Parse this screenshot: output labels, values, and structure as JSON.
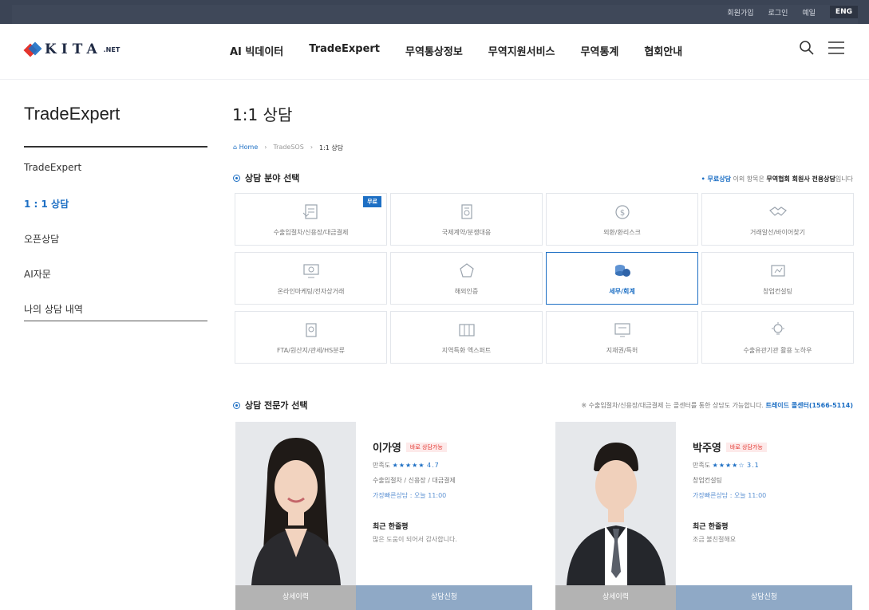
{
  "util_bar": {
    "links": [
      "회원가입",
      "로그인",
      "예일"
    ],
    "eng": "ENG"
  },
  "header": {
    "logo_text": "KITA",
    "logo_suffix": ".NET",
    "nav": [
      "AI 빅데이터",
      "TradeExpert",
      "무역통상정보",
      "무역지원서비스",
      "무역통계",
      "협회안내"
    ],
    "icons": [
      "search-icon",
      "menu-icon"
    ]
  },
  "sidebar": {
    "title": "TradeExpert",
    "items": [
      {
        "label": "TradeExpert",
        "active": false
      },
      {
        "label": "1 : 1 상담",
        "active": true
      },
      {
        "label": "오픈상담",
        "active": false
      },
      {
        "label": "AI자문",
        "active": false
      },
      {
        "label": "나의 상담 내역",
        "active": false
      }
    ]
  },
  "main": {
    "title": "1:1 상담",
    "breadcrumb": {
      "home": "Home",
      "mid": "TradeSOS",
      "current": "1:1 상담"
    },
    "field_section": {
      "heading": "상담 분야 선택",
      "note_blue": "• 무료상담",
      "note_mid": " 이외 항목은 ",
      "note_strong": "무역협회 회원사 전용상담",
      "note_end": "입니다"
    },
    "categories": [
      {
        "label": "수출입절차/신용장/대금결제",
        "icon": "document-icon",
        "badge": "무료"
      },
      {
        "label": "국제계약/분쟁대응",
        "icon": "contract-icon"
      },
      {
        "label": "외환/환리스크",
        "icon": "dollar-coin-icon"
      },
      {
        "label": "거래알선/바이어찾기",
        "icon": "handshake-icon"
      },
      {
        "label": "온라인마케팅/전자상거래",
        "icon": "monitor-icon"
      },
      {
        "label": "해외인증",
        "icon": "certificate-icon"
      },
      {
        "label": "세무/회계",
        "icon": "coins-icon",
        "selected": true
      },
      {
        "label": "창업컨설팅",
        "icon": "startup-icon"
      },
      {
        "label": "FTA/원산지/관세/HS분류",
        "icon": "tariff-icon"
      },
      {
        "label": "지역특화 엑스퍼트",
        "icon": "region-map-icon"
      },
      {
        "label": "지재권/특허",
        "icon": "patent-icon"
      },
      {
        "label": "수출유관기관 활용 노하우",
        "icon": "idea-bulb-icon"
      }
    ],
    "expert_section": {
      "heading": "상담 전문가 선택",
      "note": "※ 수출입절차/신용장/대금결제 는 콜센터를 통한 상담도 가능합니다.",
      "note_link": "트레이드 콜센터(1566-5114)"
    },
    "experts": [
      {
        "name": "이가영",
        "tag": "바로 상담가능",
        "satisfaction_label": "만족도",
        "stars": "★★★★★",
        "rating": "4.7",
        "fields": "수출입절차 / 신용장 / 대금결제",
        "available": "가장빠른상담 : 오늘 11:00",
        "review_title": "최근 한줄평",
        "review": "많은 도움이 되어서 감사합니다.",
        "btn_detail": "상세이력",
        "btn_apply": "상담신청"
      },
      {
        "name": "박주영",
        "tag": "바로 상담가능",
        "satisfaction_label": "만족도",
        "stars": "★★★★☆",
        "rating": "3.1",
        "fields": "창업컨설팅",
        "available": "가장빠른상담 : 오늘 11:00",
        "review_title": "최근 한줄평",
        "review": "조금 불친절해요",
        "btn_detail": "상세이력",
        "btn_apply": "상담신청"
      }
    ]
  },
  "colors": {
    "accent": "#1d6fc4",
    "util_bar": "#3b4455",
    "apply_button": "#8fa9c6",
    "detail_button": "#b3b3b3",
    "tag_red": "#e4342d"
  }
}
